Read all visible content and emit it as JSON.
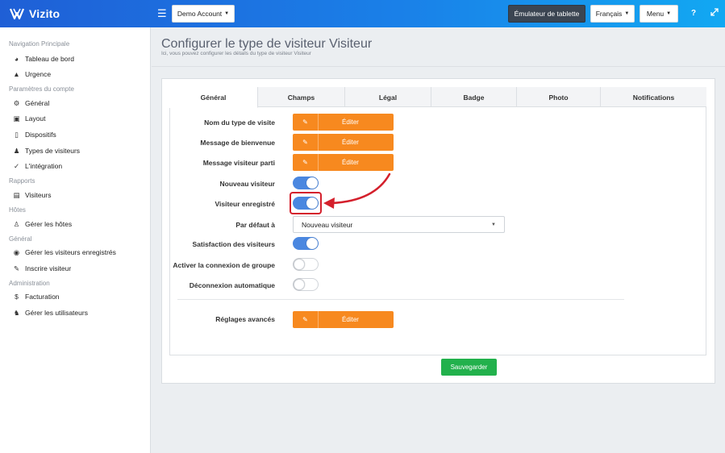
{
  "app": {
    "brand": "Vizito"
  },
  "topbar": {
    "account": "Demo Account",
    "tablet_emulator": "Émulateur de tablette",
    "language": "Français",
    "menu": "Menu",
    "help_icon": "question-icon",
    "fullscreen_icon": "expand-icon"
  },
  "sidebar": {
    "sections": [
      {
        "heading": "Navigation Principale",
        "items": [
          {
            "label": "Tableau de bord",
            "icon": "gauge-icon"
          },
          {
            "label": "Urgence",
            "icon": "warning-icon"
          }
        ]
      },
      {
        "heading": "Paramètres du compte",
        "items": [
          {
            "label": "Général",
            "icon": "gear-icon"
          },
          {
            "label": "Layout",
            "icon": "image-icon"
          },
          {
            "label": "Dispositifs",
            "icon": "tablet-icon"
          },
          {
            "label": "Types de visiteurs",
            "icon": "users-icon"
          },
          {
            "label": "L'intégration",
            "icon": "plug-icon"
          }
        ]
      },
      {
        "heading": "Rapports",
        "items": [
          {
            "label": "Visiteurs",
            "icon": "list-icon"
          }
        ]
      },
      {
        "heading": "Hôtes",
        "items": [
          {
            "label": "Gérer les hôtes",
            "icon": "person-icon"
          }
        ]
      },
      {
        "heading": "Général",
        "items": [
          {
            "label": "Gérer les visiteurs enregistrés",
            "icon": "user-circle-icon"
          },
          {
            "label": "Inscrire visiteur",
            "icon": "pencil-icon"
          }
        ]
      },
      {
        "heading": "Administration",
        "items": [
          {
            "label": "Facturation",
            "icon": "dollar-icon"
          },
          {
            "label": "Gérer les utilisateurs",
            "icon": "user-plus-icon"
          }
        ]
      }
    ]
  },
  "page": {
    "title": "Configurer le type de visiteur Visiteur",
    "subtitle": "Ici, vous pouvez configurer les détails du type de visiteur Visiteur"
  },
  "tabs": [
    "Général",
    "Champs",
    "Légal",
    "Badge",
    "Photo",
    "Notifications"
  ],
  "form": {
    "edit_label": "Éditer",
    "fields": {
      "type_name": "Nom du type de visite",
      "welcome": "Message de bienvenue",
      "departed": "Message visiteur parti",
      "new_visitor": "Nouveau visiteur",
      "registered_visitor": "Visiteur enregistré",
      "default": "Par défaut à",
      "satisfaction": "Satisfaction des visiteurs",
      "group_login": "Activer la connexion de groupe",
      "auto_logout": "Déconnexion automatique",
      "advanced": "Réglages avancés"
    },
    "toggles": {
      "new_visitor": true,
      "registered_visitor": true,
      "satisfaction": true,
      "group_login": false,
      "auto_logout": false
    },
    "default_select": "Nouveau visiteur"
  },
  "actions": {
    "save": "Sauvegarder"
  },
  "colors": {
    "accent": "#4a87e0",
    "edit": "#f7891f",
    "save": "#22b14c",
    "highlight": "#d4202c"
  }
}
